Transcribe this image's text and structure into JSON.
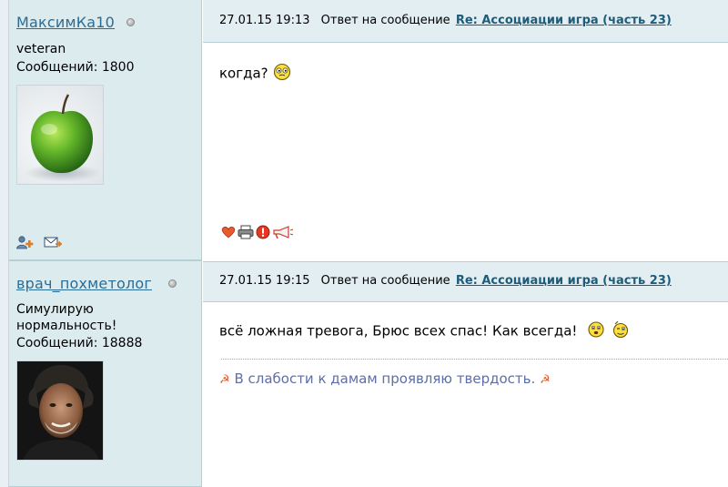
{
  "posts": [
    {
      "author": {
        "name": "МаксимКа10",
        "rank": "veteran",
        "messages_label": "Сообщений: 1800",
        "avatar_icon": "green-apple-in-snow"
      },
      "date": "27.01.15 19:13",
      "reply_text": "Ответ на сообщение",
      "thread_link": "Re: Ассоциации игра (часть 23)",
      "body": "когда?",
      "action_icons": [
        "heart-icon",
        "print-icon",
        "warning-icon",
        "megaphone-icon"
      ],
      "profile_icons": [
        "add-friend-icon",
        "email-icon"
      ]
    },
    {
      "author": {
        "name": "врач_похметолог",
        "rank_line1": "Симулирую",
        "rank_line2": "нормальность!",
        "messages_label": "Сообщений: 18888",
        "avatar_icon": "portrait-photo"
      },
      "date": "27.01.15 19:15",
      "reply_text": "Ответ на сообщение",
      "thread_link": "Re: Ассоциации игра (часть 23)",
      "body": "всё ложная тревога, Брюс всех спас! Как всегда!",
      "signature": "В слабости к дамам проявляю твердость."
    }
  ],
  "colors": {
    "author_bg": "#dcebee",
    "header_bg": "#e3eef2",
    "link": "#2b6c95",
    "signature": "#5e6ea8"
  }
}
